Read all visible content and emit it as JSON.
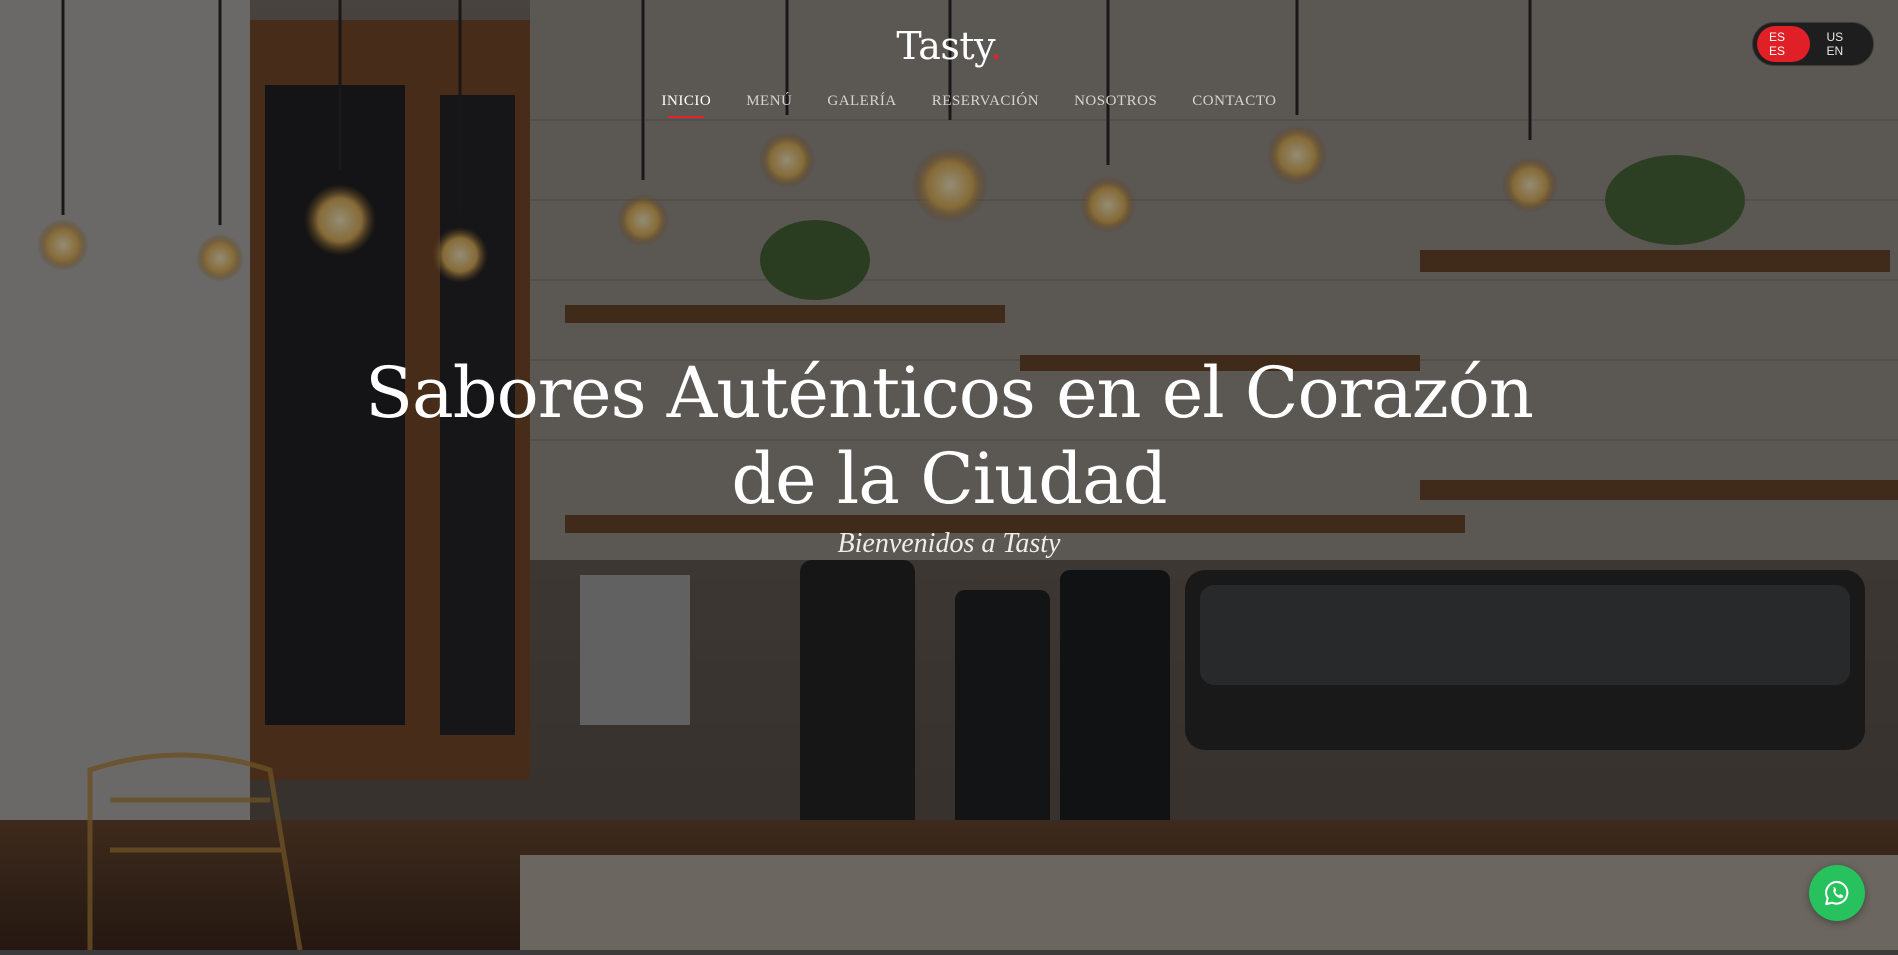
{
  "brand": {
    "name": "Tasty",
    "dot": "."
  },
  "nav": {
    "items": [
      {
        "label": "INICIO",
        "active": true
      },
      {
        "label": "MENÚ"
      },
      {
        "label": "GALERÍA"
      },
      {
        "label": "RESERVACIÓN"
      },
      {
        "label": "NOSOTROS"
      },
      {
        "label": "CONTACTO"
      }
    ]
  },
  "language": {
    "options": [
      {
        "label": "ES ES",
        "active": true
      },
      {
        "label": "US EN"
      }
    ]
  },
  "hero": {
    "headline_line1": "Sabores Auténticos en el Corazón",
    "headline_line2": "de la Ciudad",
    "subtitle": "Bienvenidos a Tasty"
  },
  "colors": {
    "accent": "#e8202a",
    "whatsapp": "#27c25e"
  },
  "icons": {
    "chat": "whatsapp-icon"
  }
}
